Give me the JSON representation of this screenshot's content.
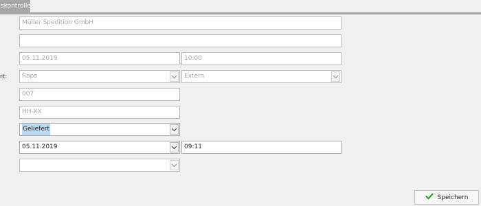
{
  "tab": {
    "label": "skontrolle"
  },
  "side_label": "rt:",
  "fields": {
    "company": {
      "value": "Müller Spedition GmbH"
    },
    "empty_field": {
      "value": ""
    },
    "date1": {
      "value": "05.11.2019"
    },
    "time1": {
      "value": "10:00"
    },
    "product": {
      "value": "Raps"
    },
    "source": {
      "value": "Extern"
    },
    "number": {
      "value": "007"
    },
    "plate": {
      "value": "HH-XX"
    },
    "status": {
      "value": "Geliefert"
    },
    "date2": {
      "value": "05.11.2019"
    },
    "time2": {
      "value": "09:11"
    },
    "last_select": {
      "value": ""
    }
  },
  "save_button": {
    "label": "Speichern",
    "icon": "checkmark-icon",
    "icon_color": "#2e9e2e"
  },
  "colors": {
    "tab_bg": "#a6a6a6",
    "selection": "#bcd7ee"
  }
}
